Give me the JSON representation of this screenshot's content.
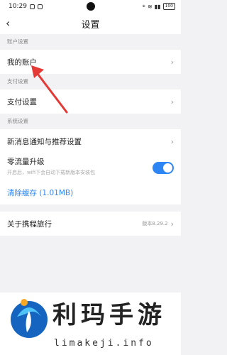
{
  "status_bar": {
    "time": "10:29",
    "battery": "100"
  },
  "nav": {
    "title": "设置"
  },
  "sections": {
    "account": {
      "header": "账户设置",
      "items": [
        {
          "label": "我的账户"
        }
      ]
    },
    "payment": {
      "header": "支付设置",
      "items": [
        {
          "label": "支付设置"
        }
      ]
    },
    "system": {
      "header": "系统设置",
      "notification_label": "新消息通知与推荐设置",
      "zero_traffic_label": "零流量升级",
      "zero_traffic_hint": "开启后，wifi下会自动下载新版本安装包",
      "zero_traffic_enabled": true,
      "clear_cache_label": "清除缓存 (1.01MB)"
    },
    "about": {
      "label": "关于携程旅行",
      "version": "版本8.29.2"
    }
  },
  "watermark": {
    "title": "利玛手游",
    "url": "limakeji.info"
  },
  "colors": {
    "accent": "#2e86f5",
    "annotation": "#e53935"
  }
}
